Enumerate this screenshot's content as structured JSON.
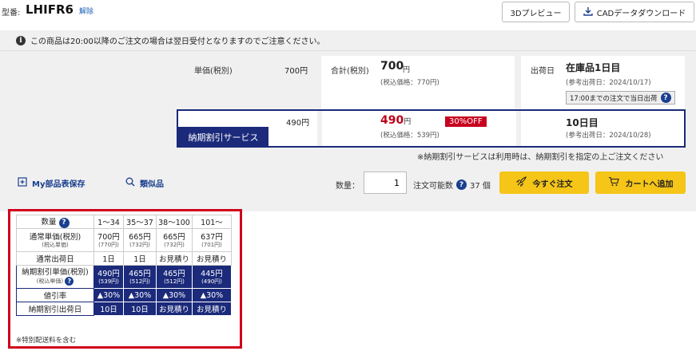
{
  "header": {
    "model_label": "型番:",
    "model_code": "LHIFR6",
    "unlock_label": "解除",
    "preview_button": "3Dプレビュー",
    "cad_button": "CADデータダウンロード"
  },
  "notice": "この商品は20:00以降のご注文の場合は翌日受付となりますのでご注意ください。",
  "pricing": {
    "unit_price_label": "単価(税別)",
    "unit_price": "700円",
    "total_label": "合計(税別)",
    "total_value": "700",
    "total_unit": "円",
    "total_tax_in": "(税込価格：770円)",
    "ship_label": "出荷日",
    "ship_value": "在庫品1日目",
    "ship_ref": "(参考出荷日：2024/10/17)",
    "same_day_note": "17:00までの注文で当日出荷"
  },
  "service": {
    "tab_label": "納期割引サービス",
    "unit_price": "490円",
    "price": "490",
    "price_unit": "円",
    "off_badge": "30%OFF",
    "tax_in": "(税込価格：539円)",
    "days": "10日目",
    "ref_date": "(参考出荷日：2024/10/28)",
    "note": "※納期割引サービスは利用時は、納期割引を指定の上ご注文ください"
  },
  "actions": {
    "bom_save": "My部品表保存",
    "similar": "類似品",
    "qty_label": "数量：",
    "qty_value": "1",
    "avail_label": "注文可能数",
    "avail_value": "37 個",
    "order_now": "今すぐ注文",
    "add_cart": "カートへ追加"
  },
  "price_table": {
    "qty_header": "数量",
    "qty_ranges": [
      "1～34",
      "35～37",
      "38～100",
      "101～"
    ],
    "normal_price_label": "通常単価(税別)",
    "normal_price_sub": "(税込単価)",
    "normal_prices": [
      "700円",
      "665円",
      "665円",
      "637円"
    ],
    "normal_prices_tax": [
      "(770円)",
      "(732円)",
      "(732円)",
      "(701円)"
    ],
    "normal_ship_label": "通常出荷日",
    "normal_ship": [
      "1日",
      "1日",
      "お見積り",
      "お見積り"
    ],
    "disc_price_label": "納期割引単価(税別)",
    "disc_price_sub": "(税込単価)",
    "disc_prices": [
      "490円",
      "465円",
      "465円",
      "445円"
    ],
    "disc_prices_tax": [
      "(539円)",
      "(512円)",
      "(512円)",
      "(490円)"
    ],
    "disc_rate_label": "値引率",
    "disc_rates": [
      "▲30%",
      "▲30%",
      "▲30%",
      "▲30%"
    ],
    "disc_ship_label": "納期割引出荷日",
    "disc_ship": [
      "10日",
      "10日",
      "お見積り",
      "お見積り"
    ]
  },
  "footnote": "※特別配送料を含む",
  "colors": {
    "navy": "#1b2a7a",
    "red": "#c0001a",
    "yellow": "#f5c518",
    "highlight": "#d0001a"
  }
}
